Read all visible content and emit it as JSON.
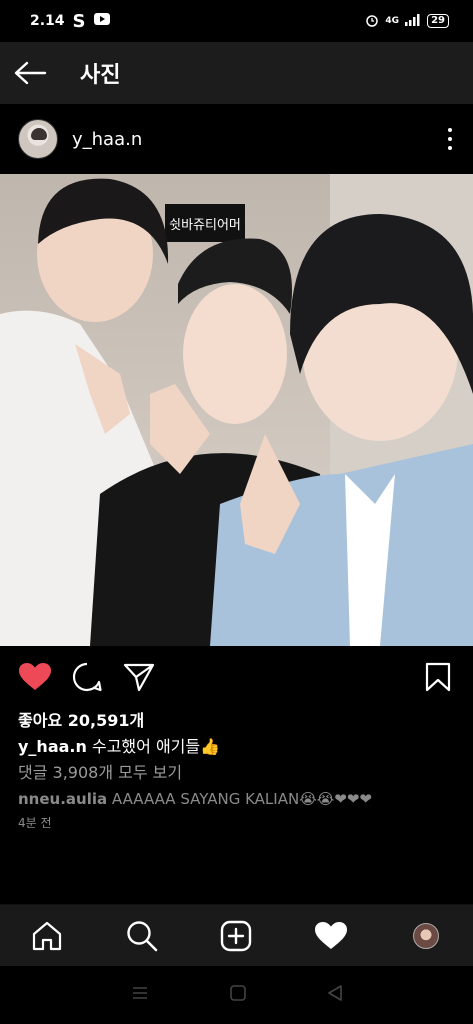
{
  "status_bar": {
    "time": "2.14",
    "network": "4G",
    "battery": "29"
  },
  "header": {
    "title": "사진"
  },
  "post": {
    "username": "y_haa.n",
    "photo_sign_text": "쉿바쥬티어머",
    "likes": "좋아요 20,591개",
    "caption_user": "y_haa.n",
    "caption_text": "수고했어 애기들👍",
    "comments_link": "댓글 3,908개 모두 보기",
    "comment_user": "nneu.aulia",
    "comment_text": "AAAAAA SAYANG KALIAN😭😭❤❤❤",
    "timestamp": "4분 전"
  },
  "colors": {
    "like_red": "#ed4956",
    "header_bg": "#1c1c1c",
    "nav_bg": "#1a1a1a",
    "muted_text": "#8a8a8a"
  },
  "icons": {
    "back": "arrow-left-icon",
    "more": "more-vertical-icon",
    "like": "heart-filled-icon",
    "comment": "comment-bubble-icon",
    "share": "paper-plane-icon",
    "save": "bookmark-icon",
    "home": "home-icon",
    "search": "search-icon",
    "add": "add-post-icon",
    "activity": "heart-icon",
    "profile": "profile-avatar"
  }
}
